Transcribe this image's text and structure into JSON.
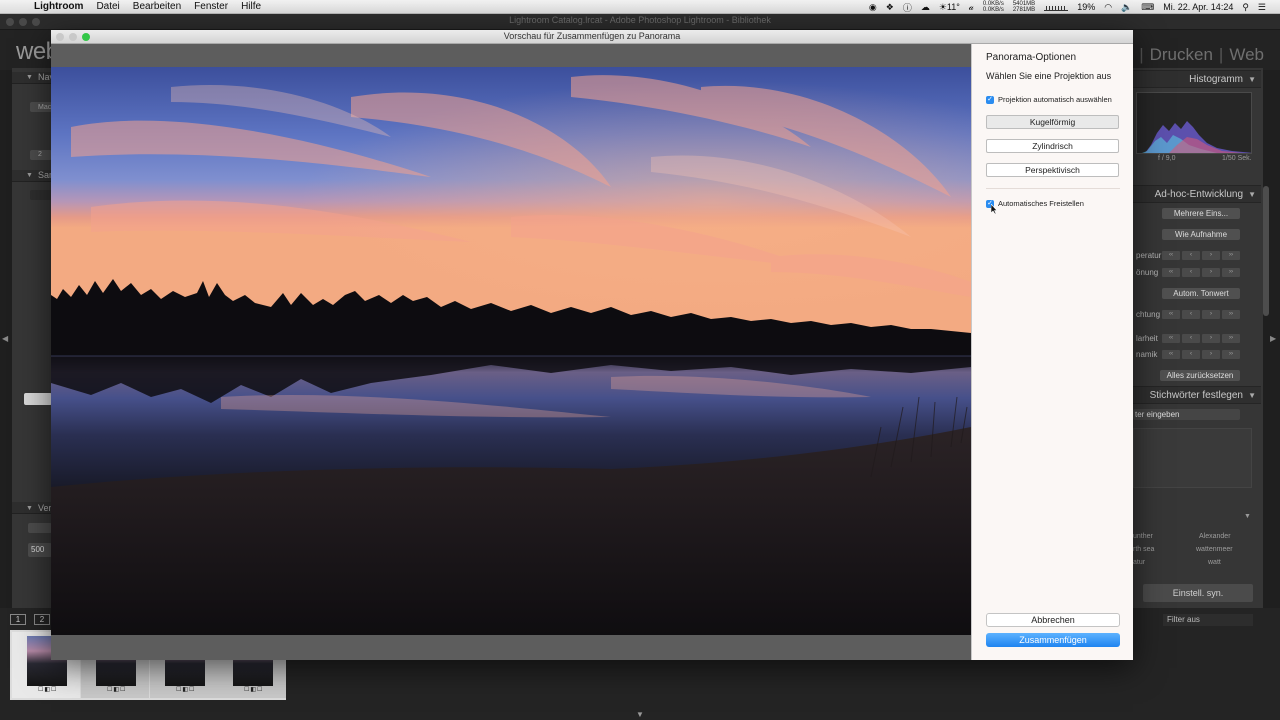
{
  "menubar": {
    "app_name": "Lightroom",
    "menus": [
      "Datei",
      "Bearbeiten",
      "Fenster",
      "Hilfe"
    ],
    "status": {
      "temperature": "11°",
      "net_up": "0.0KB/s",
      "net_down": "0.0KB/s",
      "mem1": "5401MB",
      "mem2": "2781MB",
      "battery": "19%",
      "datetime": "Mi. 22. Apr. 14:24"
    }
  },
  "lightroom": {
    "window_title": "Lightroom Catalog.lrcat - Adobe Photoshop Lightroom - Bibliothek",
    "logo_partial": "web",
    "modules": [
      "Drucken",
      "Web"
    ],
    "left_panel": {
      "heads": [
        "Nav",
        "Sam",
        "Ver"
      ],
      "rows": [
        "Mac",
        "2"
      ],
      "bottom_number": "500"
    },
    "right_panel": {
      "histogram_title": "Histogramm",
      "aperture": "f / 9,0",
      "shutter": "1/50 Sek.",
      "quick_develop_title": "Ad-hoc-Entwicklung",
      "preset_value": "Mehrere Eins...",
      "wb_value": "Wie Aufnahme",
      "row_temperature": "peratur",
      "row_tint": "önung",
      "auto_tone": "Autom. Tonwert",
      "row_exposure": "chtung",
      "row_clarity": "larheit",
      "row_vibrance": "namik",
      "reset_all": "Alles zurücksetzen",
      "keywords_title": "Stichwörter festlegen",
      "keyword_placeholder": "ter eingeben",
      "keyword_suggestions": [
        "unther",
        "Alexander",
        "rth sea",
        "wattenmeer",
        "atur",
        "watt"
      ],
      "sync_settings": "Einstell. syn."
    },
    "filter": "Filter aus",
    "pages": [
      "1",
      "2"
    ],
    "film_badges": "☐◧☐"
  },
  "dialog": {
    "title": "Vorschau für Zusammenfügen zu Panorama",
    "options": {
      "title": "Panorama-Optionen",
      "subtitle": "Wählen Sie eine Projektion aus",
      "auto_projection_label": "Projektion automatisch auswählen",
      "auto_projection_checked": true,
      "projections": [
        "Kugelförmig",
        "Zylindrisch",
        "Perspektivisch"
      ],
      "selected_projection": "Kugelförmig",
      "auto_crop_label": "Automatisches Freistellen",
      "auto_crop_checked": true,
      "cancel_label": "Abbrechen",
      "merge_label": "Zusammenfügen"
    }
  },
  "colors": {
    "accent_blue": "#2a8cf0",
    "merge_button": "#1f84f0",
    "dialog_panel_bg": "#fbf7f5"
  }
}
